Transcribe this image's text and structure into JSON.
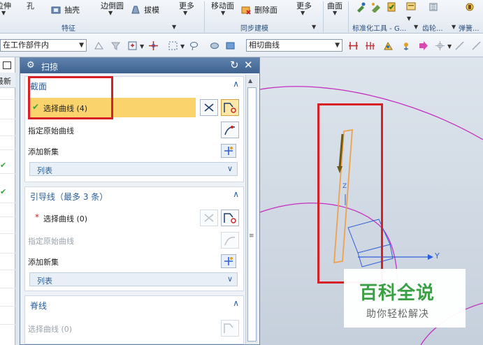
{
  "ribbon": {
    "tools": [
      {
        "label": "拉伸",
        "icon": "extrude-icon"
      },
      {
        "label": "孔",
        "icon": "hole-icon"
      },
      {
        "label": "抽壳",
        "icon": "shell-icon"
      },
      {
        "label": "边倒圆",
        "icon": "edge-blend-icon"
      },
      {
        "label": "拔模",
        "icon": "draft-icon"
      },
      {
        "label": "更多",
        "icon": "more-icon"
      },
      {
        "label": "移动面",
        "icon": "move-face-icon"
      },
      {
        "label": "删除面",
        "icon": "delete-face-icon"
      },
      {
        "label": "更多",
        "icon": "more-icon"
      },
      {
        "label": "曲面",
        "icon": "surface-icon"
      }
    ],
    "groups": [
      "特征",
      "同步建模",
      "标准化工具 - G...",
      "齿轮...",
      "弹簧..."
    ]
  },
  "toolbar": {
    "scope_combo": "在工作部件内",
    "curve_rule_combo": "相切曲线"
  },
  "dialog": {
    "title": "扫掠",
    "section1": {
      "title": "截面",
      "select_curve": "选择曲线 (4)",
      "specify_origin": "指定原始曲线",
      "add_new_set": "添加新集",
      "list": "列表"
    },
    "section2": {
      "title": "引导线（最多 3 条）",
      "select_curve": "选择曲线 (0)",
      "specify_origin": "指定原始曲线",
      "add_new_set": "添加新集",
      "list": "列表"
    },
    "section3": {
      "title": "脊线",
      "select_curve": "选择曲线 (0)"
    }
  },
  "navigator": {
    "header_fragment": "最新"
  },
  "viewport": {
    "axis_y": "Y",
    "axis_z": "Z"
  },
  "watermark": {
    "title": "百科全说",
    "subtitle": "助你轻松解决"
  },
  "colors": {
    "highlight_row": "#fbd36c",
    "annotation_red": "#d91f26",
    "curve_magenta": "#c430c0",
    "sweep_orange": "#f0a04a",
    "axis_blue": "#2f5fd8",
    "watermark_green": "#3aa043"
  }
}
